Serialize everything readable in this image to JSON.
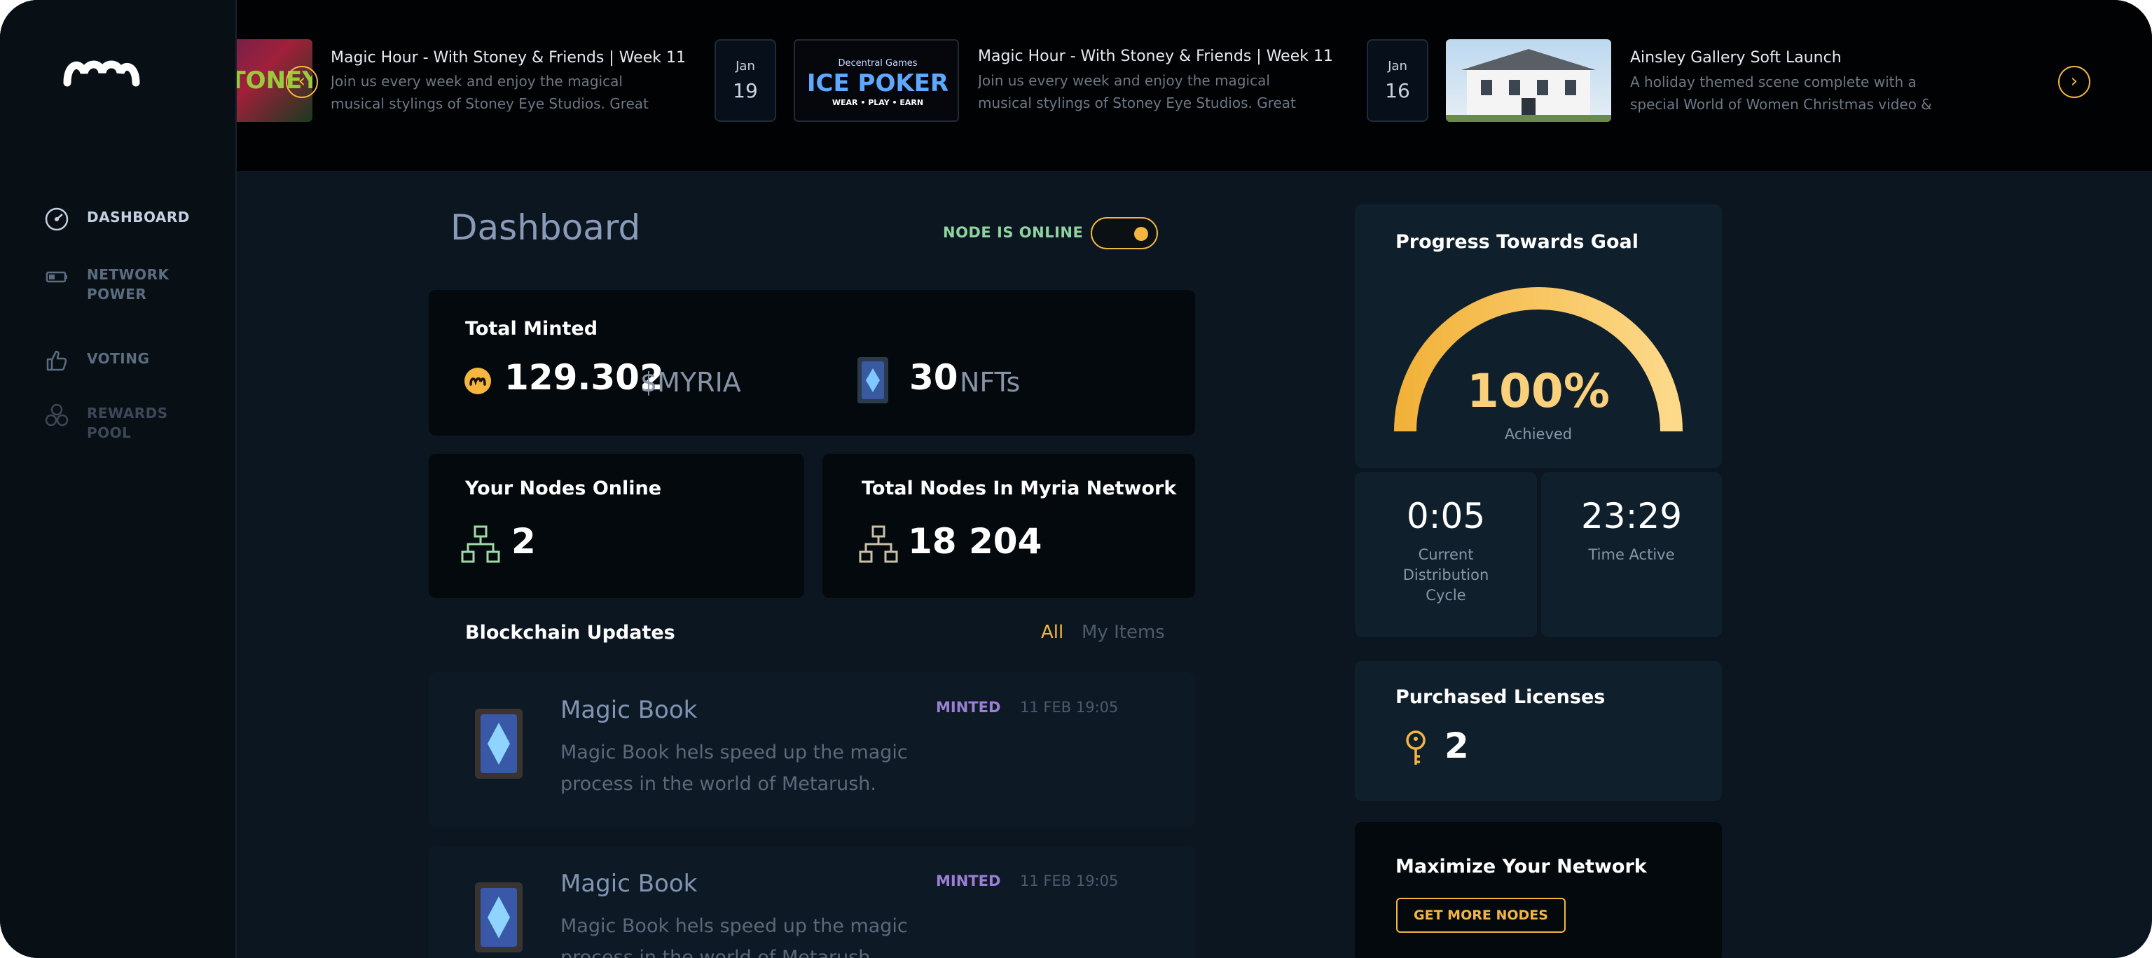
{
  "sidebar": {
    "items": [
      {
        "label": "DASHBOARD"
      },
      {
        "label": "NETWORK POWER"
      },
      {
        "label": "VOTING"
      },
      {
        "label": "REWARDS POOL"
      }
    ]
  },
  "events": [
    {
      "title": "Magic Hour - With Stoney & Friends | Week 11",
      "desc": "Join us every week and enjoy the magical musical stylings of Stoney Eye Studios. Great"
    },
    {
      "month": "Jan",
      "day": "19",
      "title": "Magic Hour - With Stoney & Friends | Week 11",
      "desc": "Join us every week and enjoy the magical musical stylings of Stoney Eye Studios. Great",
      "thumb_text": "ICE POKER",
      "thumb_sub": "WEAR • PLAY • EARN",
      "thumb_brand": "Decentral Games"
    },
    {
      "month": "Jan",
      "day": "16",
      "title": "Ainsley Gallery Soft Launch",
      "desc": "A holiday themed scene complete with a special World of Women Christmas video &"
    }
  ],
  "main": {
    "title": "Dashboard",
    "node_status": "NODE IS ONLINE",
    "node_online": true,
    "total_minted": {
      "title": "Total Minted",
      "amount": "129.302",
      "currency": "$MYRIA",
      "nft_count": "30",
      "nft_unit": "NFTs"
    },
    "your_nodes": {
      "title": "Your Nodes Online",
      "value": "2"
    },
    "total_nodes": {
      "title": "Total Nodes In Myria Network",
      "value": "18 204"
    },
    "updates": {
      "title": "Blockchain Updates",
      "filters": [
        "All",
        "My Items"
      ],
      "items": [
        {
          "title": "Magic Book",
          "desc": "Magic Book hels speed up the magic process in the world of Metarush.",
          "status": "MINTED",
          "time": "11 FEB 19:05"
        },
        {
          "title": "Magic Book",
          "desc": "Magic Book hels speed up the magic process in the world of Metarush.",
          "status": "MINTED",
          "time": "11 FEB 19:05"
        }
      ]
    }
  },
  "right": {
    "progress": {
      "title": "Progress Towards Goal",
      "value": "100%",
      "label": "Achieved",
      "fraction": 1.0
    },
    "cycle": {
      "value": "0:05",
      "label": "Current Distribution Cycle"
    },
    "active": {
      "value": "23:29",
      "label": "Time Active"
    },
    "licenses": {
      "title": "Purchased Licenses",
      "value": "2"
    },
    "maximize": {
      "title": "Maximize Your Network",
      "button": "GET MORE NODES"
    }
  },
  "colors": {
    "accent": "#f4b63f",
    "online": "#8fd3a0",
    "minted": "#9b7fd4"
  }
}
